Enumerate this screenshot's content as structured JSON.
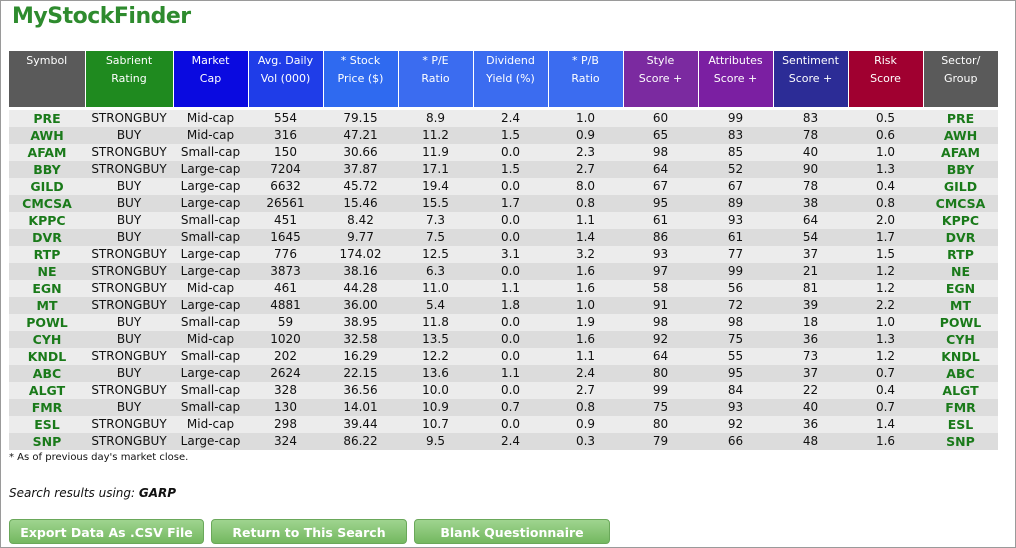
{
  "app": {
    "logo": "MyStockFinder"
  },
  "colors": {
    "symbol": "#505050",
    "rating": "#1f8a1f",
    "blue": "#0a0aee",
    "blue_light": "#3b6cf0",
    "purple": "#7b1fa2",
    "navy": "#2a2a8a",
    "maroon": "#a00030",
    "symbol_text": "#1a7a1a"
  },
  "columns": [
    {
      "label_1": "Symbol",
      "label_2": "",
      "color": "#5a5a5a"
    },
    {
      "label_1": "Sabrient",
      "label_2": "Rating",
      "color": "#1f8a1f"
    },
    {
      "label_1": "Market",
      "label_2": "Cap",
      "color": "#0a0ae0"
    },
    {
      "label_1": "Avg. Daily",
      "label_2": "Vol (000)",
      "color": "#1f3de8"
    },
    {
      "label_1": "* Stock",
      "label_2": "Price ($)",
      "color": "#2f6af0"
    },
    {
      "label_1": "* P/E",
      "label_2": "Ratio",
      "color": "#3b6cf0"
    },
    {
      "label_1": "Dividend",
      "label_2": "Yield (%)",
      "color": "#3b6cf0"
    },
    {
      "label_1": "* P/B",
      "label_2": "Ratio",
      "color": "#3b6cf0"
    },
    {
      "label_1": "Style",
      "label_2": "Score +",
      "color": "#7b2aa0"
    },
    {
      "label_1": "Attributes",
      "label_2": "Score +",
      "color": "#7b1fa2"
    },
    {
      "label_1": "Sentiment",
      "label_2": "Score +",
      "color": "#2c2c96"
    },
    {
      "label_1": "Risk",
      "label_2": "Score",
      "color": "#a00030"
    },
    {
      "label_1": "Sector/",
      "label_2": "Group",
      "color": "#5a5a5a"
    }
  ],
  "rows": [
    [
      "PRE",
      "STRONGBUY",
      "Mid-cap",
      "554",
      "79.15",
      "8.9",
      "2.4",
      "1.0",
      "60",
      "99",
      "83",
      "0.5",
      "PRE"
    ],
    [
      "AWH",
      "BUY",
      "Mid-cap",
      "316",
      "47.21",
      "11.2",
      "1.5",
      "0.9",
      "65",
      "83",
      "78",
      "0.6",
      "AWH"
    ],
    [
      "AFAM",
      "STRONGBUY",
      "Small-cap",
      "150",
      "30.66",
      "11.9",
      "0.0",
      "2.3",
      "98",
      "85",
      "40",
      "1.0",
      "AFAM"
    ],
    [
      "BBY",
      "STRONGBUY",
      "Large-cap",
      "7204",
      "37.87",
      "17.1",
      "1.5",
      "2.7",
      "64",
      "52",
      "90",
      "1.3",
      "BBY"
    ],
    [
      "GILD",
      "BUY",
      "Large-cap",
      "6632",
      "45.72",
      "19.4",
      "0.0",
      "8.0",
      "67",
      "67",
      "78",
      "0.4",
      "GILD"
    ],
    [
      "CMCSA",
      "BUY",
      "Large-cap",
      "26561",
      "15.46",
      "15.5",
      "1.7",
      "0.8",
      "95",
      "89",
      "38",
      "0.8",
      "CMCSA"
    ],
    [
      "KPPC",
      "BUY",
      "Small-cap",
      "451",
      "8.42",
      "7.3",
      "0.0",
      "1.1",
      "61",
      "93",
      "64",
      "2.0",
      "KPPC"
    ],
    [
      "DVR",
      "BUY",
      "Small-cap",
      "1645",
      "9.77",
      "7.5",
      "0.0",
      "1.4",
      "86",
      "61",
      "54",
      "1.7",
      "DVR"
    ],
    [
      "RTP",
      "STRONGBUY",
      "Large-cap",
      "776",
      "174.02",
      "12.5",
      "3.1",
      "3.2",
      "93",
      "77",
      "37",
      "1.5",
      "RTP"
    ],
    [
      "NE",
      "STRONGBUY",
      "Large-cap",
      "3873",
      "38.16",
      "6.3",
      "0.0",
      "1.6",
      "97",
      "99",
      "21",
      "1.2",
      "NE"
    ],
    [
      "EGN",
      "STRONGBUY",
      "Mid-cap",
      "461",
      "44.28",
      "11.0",
      "1.1",
      "1.6",
      "58",
      "56",
      "81",
      "1.2",
      "EGN"
    ],
    [
      "MT",
      "STRONGBUY",
      "Large-cap",
      "4881",
      "36.00",
      "5.4",
      "1.8",
      "1.0",
      "91",
      "72",
      "39",
      "2.2",
      "MT"
    ],
    [
      "POWL",
      "BUY",
      "Small-cap",
      "59",
      "38.95",
      "11.8",
      "0.0",
      "1.9",
      "98",
      "98",
      "18",
      "1.0",
      "POWL"
    ],
    [
      "CYH",
      "BUY",
      "Mid-cap",
      "1020",
      "32.58",
      "13.5",
      "0.0",
      "1.6",
      "92",
      "75",
      "36",
      "1.3",
      "CYH"
    ],
    [
      "KNDL",
      "STRONGBUY",
      "Small-cap",
      "202",
      "16.29",
      "12.2",
      "0.0",
      "1.1",
      "64",
      "55",
      "73",
      "1.2",
      "KNDL"
    ],
    [
      "ABC",
      "BUY",
      "Large-cap",
      "2624",
      "22.15",
      "13.6",
      "1.1",
      "2.4",
      "80",
      "95",
      "37",
      "0.7",
      "ABC"
    ],
    [
      "ALGT",
      "STRONGBUY",
      "Small-cap",
      "328",
      "36.56",
      "10.0",
      "0.0",
      "2.7",
      "99",
      "84",
      "22",
      "0.4",
      "ALGT"
    ],
    [
      "FMR",
      "BUY",
      "Small-cap",
      "130",
      "14.01",
      "10.9",
      "0.7",
      "0.8",
      "75",
      "93",
      "40",
      "0.7",
      "FMR"
    ],
    [
      "ESL",
      "STRONGBUY",
      "Mid-cap",
      "298",
      "39.44",
      "10.7",
      "0.0",
      "0.9",
      "80",
      "92",
      "36",
      "1.4",
      "ESL"
    ],
    [
      "SNP",
      "STRONGBUY",
      "Large-cap",
      "324",
      "86.22",
      "9.5",
      "2.4",
      "0.3",
      "79",
      "66",
      "48",
      "1.6",
      "SNP"
    ]
  ],
  "footer": {
    "note": "* As of previous day's market close.",
    "search_prefix": "Search results using: ",
    "search_name": "GARP"
  },
  "buttons": {
    "export": "Export Data As .CSV File",
    "return": "Return to This Search",
    "blank": "Blank Questionnaire"
  }
}
